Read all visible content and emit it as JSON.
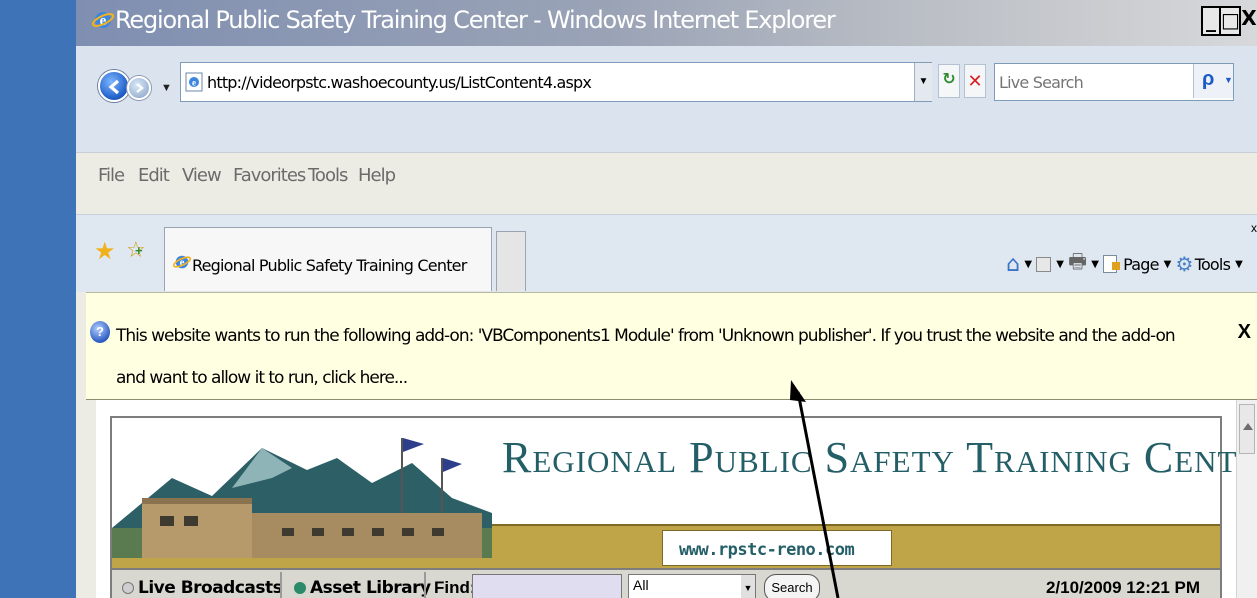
{
  "window": {
    "title": "Regional Public Safety Training Center - Windows Internet Explorer",
    "controls": {
      "minimize": "_",
      "maximize": "□",
      "close": "X"
    }
  },
  "nav": {
    "address_url": "http://videorpstc.washoecounty.us/ListContent4.aspx",
    "search_placeholder": "Live Search"
  },
  "menu": [
    "File",
    "Edit",
    "View",
    "Favorites",
    "Tools",
    "Help"
  ],
  "tabs": {
    "active_tab_label": "Regional Public Safety Training Center"
  },
  "command_bar": {
    "page_label": "Page",
    "tools_label": "Tools",
    "close_label": "x"
  },
  "infobar": {
    "message": "This website wants to run the following add-on: 'VBComponents1 Module' from 'Unknown publisher'. If you trust the website and the add-on and want to allow it to run, click here...",
    "close": "X"
  },
  "site": {
    "title": "Regional Public Safety Training Center",
    "url": "www.rpstc-reno.com",
    "nav": {
      "live_broadcasts": "Live Broadcasts",
      "asset_library": "Asset Library",
      "find_label": "Find:",
      "find_select": "All",
      "search_button": "Search",
      "datetime": "2/10/2009 12:21 PM"
    }
  },
  "colors": {
    "left_bar": "#3f73b7",
    "infobar_bg": "#ffffe1",
    "site_title": "#245f68",
    "gold_band": "#c0a548"
  }
}
